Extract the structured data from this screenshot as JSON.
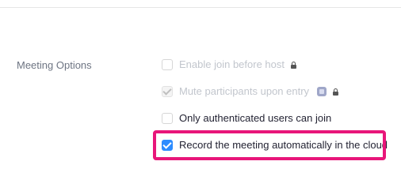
{
  "section": {
    "label": "Meeting Options"
  },
  "options": [
    {
      "label": "Enable join before host",
      "checked": false,
      "disabled": true,
      "locked": true
    },
    {
      "label": "Mute participants upon entry",
      "checked": true,
      "disabled": true,
      "locked": true,
      "badge": true
    },
    {
      "label": "Only authenticated users can join",
      "checked": false,
      "disabled": false,
      "locked": false
    },
    {
      "label": "Record the meeting automatically in the cloud",
      "checked": true,
      "disabled": false,
      "locked": false,
      "highlighted": true
    }
  ],
  "colors": {
    "accent": "#2d8cff",
    "highlight": "#e8167a",
    "disabled_text": "#c2c6cd",
    "label_text": "#6e7583",
    "enabled_text": "#232333"
  },
  "icons": {
    "lock": "lock-icon",
    "badge": "info-badge-icon",
    "check": "check-icon"
  }
}
